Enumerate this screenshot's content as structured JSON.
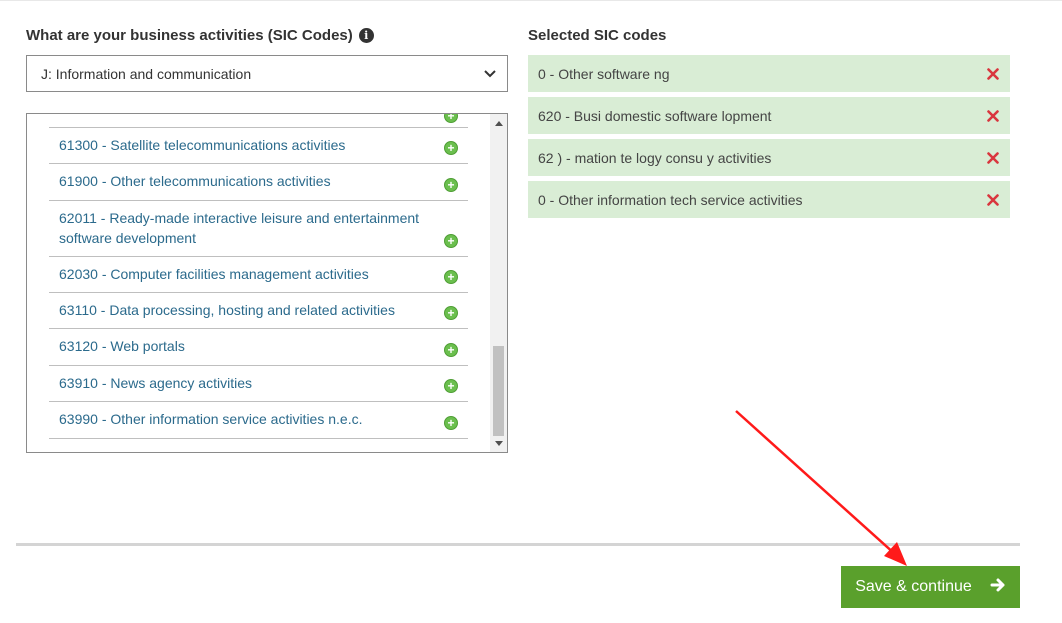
{
  "form": {
    "left_heading": "What are your business activities (SIC Codes)",
    "right_heading": "Selected SIC codes",
    "section_select": {
      "value": "J: Information and communication"
    },
    "available_codes": [
      "61300 - Satellite telecommunications activities",
      "61900 - Other telecommunications activities",
      "62011 - Ready-made interactive leisure and entertainment software development",
      "62030 - Computer facilities management activities",
      "63110 - Data processing, hosting and related activities",
      "63120 - Web portals",
      "63910 - News agency activities",
      "63990 - Other information service activities n.e.c."
    ],
    "selected_codes": [
      "0 - Other software ng",
      "620 - Busi domestic software lopment",
      "62 ) - mation te logy consu y activities",
      "0 - Other information tech service activities"
    ],
    "save_label": "Save & continue"
  },
  "colors": {
    "link": "#2b6a8c",
    "chip_bg": "#d9edd5",
    "add_icon": "#6bbf4e",
    "remove_icon": "#d9363e",
    "button": "#5aa02c",
    "annotation_arrow": "#ff1a1a"
  },
  "icons": {
    "info": "info-circle-icon",
    "add": "plus-circle-icon",
    "remove": "x-icon",
    "button": "arrow-right-icon",
    "select": "chevron-down-icon"
  }
}
